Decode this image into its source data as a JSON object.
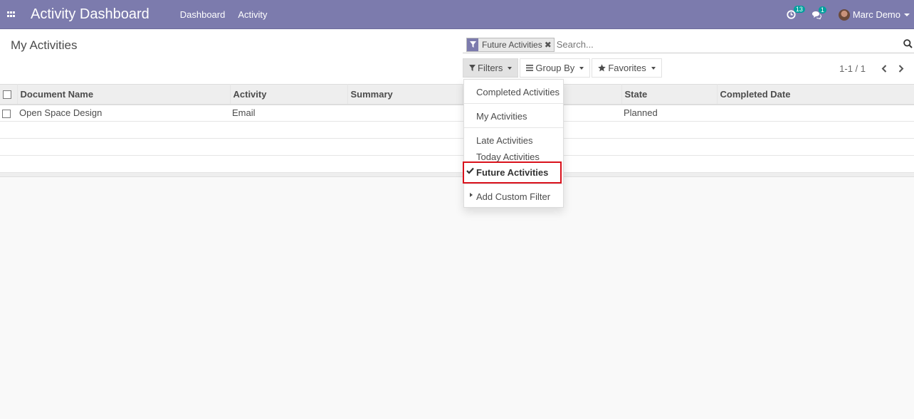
{
  "navbar": {
    "app_title": "Activity Dashboard",
    "menu": [
      "Dashboard",
      "Activity"
    ],
    "activity_count": "13",
    "message_count": "1",
    "user_name": "Marc Demo",
    "bg_color": "#7c7bad"
  },
  "control_panel": {
    "title": "My Activities",
    "facet_label": "Future Activities",
    "search_placeholder": "Search...",
    "filters_label": "Filters",
    "groupby_label": "Group By",
    "favorites_label": "Favorites",
    "pager_value": "1-1 / 1"
  },
  "table": {
    "columns": [
      "Document Name",
      "Activity",
      "Summary",
      "",
      "State",
      "Completed Date"
    ],
    "rows": [
      {
        "document_name": "Open Space Design",
        "activity": "Email",
        "summary": "",
        "col4": "",
        "state": "Planned",
        "completed_date": ""
      }
    ]
  },
  "filters_dropdown": {
    "items": [
      {
        "label": "Completed Activities",
        "checked": false
      },
      {
        "label": "My Activities",
        "checked": false
      },
      {
        "label": "Late Activities",
        "checked": false
      },
      {
        "label": "Today Activities",
        "checked": false
      },
      {
        "label": "Future Activities",
        "checked": true
      },
      {
        "label": "Add Custom Filter",
        "checked": false
      }
    ],
    "highlight_color": "#d9111b"
  }
}
